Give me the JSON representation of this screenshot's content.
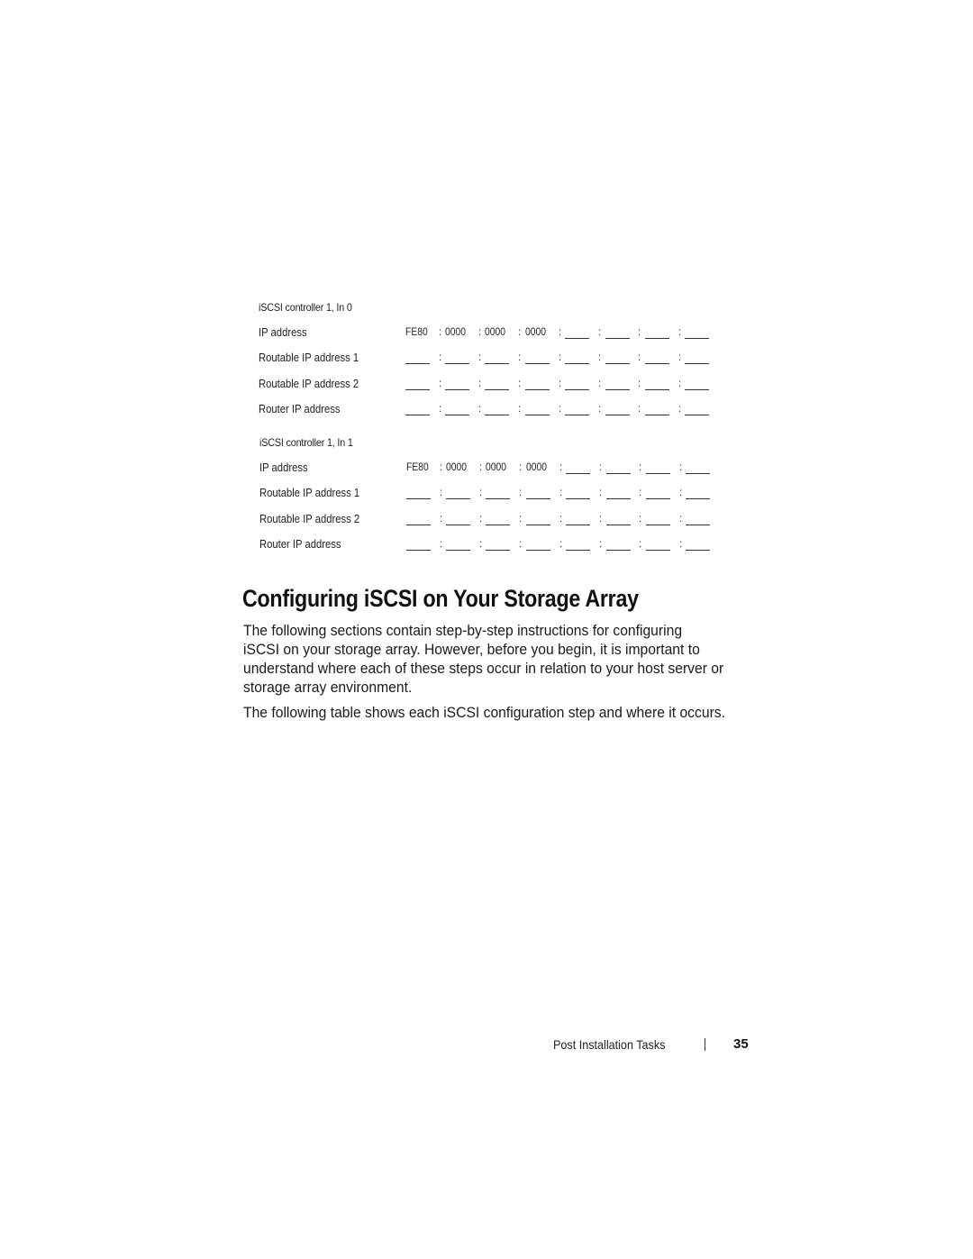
{
  "address_blocks": [
    {
      "title": "iSCSI controller 1, In 0",
      "rows": [
        {
          "label": "IP address",
          "segments": [
            "FE80",
            "0000",
            "0000",
            "0000",
            "",
            "",
            "",
            ""
          ]
        },
        {
          "label": "Routable IP address 1",
          "segments": [
            "",
            "",
            "",
            "",
            "",
            "",
            "",
            ""
          ]
        },
        {
          "label": "Routable IP address 2",
          "segments": [
            "",
            "",
            "",
            "",
            "",
            "",
            "",
            ""
          ]
        },
        {
          "label": "Router IP address",
          "segments": [
            "",
            "",
            "",
            "",
            "",
            "",
            "",
            ""
          ]
        }
      ]
    },
    {
      "title": "iSCSI controller 1, In 1",
      "rows": [
        {
          "label": "IP address",
          "segments": [
            "FE80",
            "0000",
            "0000",
            "0000",
            "",
            "",
            "",
            ""
          ]
        },
        {
          "label": "Routable IP address 1",
          "segments": [
            "",
            "",
            "",
            "",
            "",
            "",
            "",
            ""
          ]
        },
        {
          "label": "Routable IP address 2",
          "segments": [
            "",
            "",
            "",
            "",
            "",
            "",
            "",
            ""
          ]
        },
        {
          "label": "Router IP address",
          "segments": [
            "",
            "",
            "",
            "",
            "",
            "",
            "",
            ""
          ]
        }
      ]
    }
  ],
  "section": {
    "title": "Configuring iSCSI on Your Storage Array",
    "paragraph1_lines": [
      "The following sections contain step-by-step instructions for configuring",
      "iSCSI on your storage array. However, before you begin, it is important to",
      "understand where each of these steps occur in relation to your host server or",
      "storage array environment."
    ],
    "paragraph2": "The following table shows each iSCSI configuration step and where it occurs."
  },
  "footer": {
    "chapter": "Post Installation Tasks",
    "page_number": "35"
  }
}
